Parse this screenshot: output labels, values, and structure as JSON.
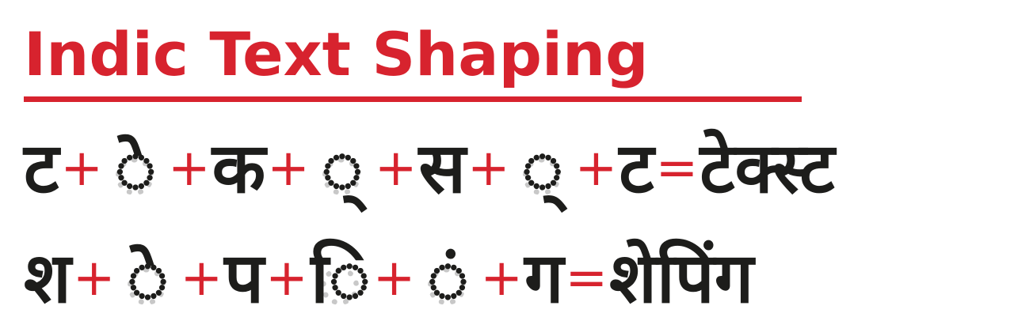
{
  "title": "Indic Text Shaping",
  "colors": {
    "title": "#d7232e",
    "glyph": "#1d1d1b",
    "operator": "#d7232e",
    "placeholder": "#c8c8c8"
  },
  "rows": [
    {
      "parts": [
        {
          "kind": "glyph",
          "text": "ट"
        },
        {
          "kind": "op",
          "text": "+"
        },
        {
          "kind": "mark",
          "text": "े"
        },
        {
          "kind": "op",
          "text": "+"
        },
        {
          "kind": "glyph",
          "text": "क"
        },
        {
          "kind": "op",
          "text": "+"
        },
        {
          "kind": "mark",
          "text": "्"
        },
        {
          "kind": "op",
          "text": "+"
        },
        {
          "kind": "glyph",
          "text": "स"
        },
        {
          "kind": "op",
          "text": "+"
        },
        {
          "kind": "mark",
          "text": "्"
        },
        {
          "kind": "op",
          "text": "+"
        },
        {
          "kind": "glyph",
          "text": "ट"
        },
        {
          "kind": "op",
          "text": "="
        },
        {
          "kind": "result",
          "text": "टेक्स्ट"
        }
      ]
    },
    {
      "parts": [
        {
          "kind": "glyph",
          "text": "श"
        },
        {
          "kind": "op",
          "text": "+"
        },
        {
          "kind": "mark",
          "text": "े"
        },
        {
          "kind": "op",
          "text": "+"
        },
        {
          "kind": "glyph",
          "text": "प"
        },
        {
          "kind": "op",
          "text": "+"
        },
        {
          "kind": "mark",
          "text": "ि"
        },
        {
          "kind": "op",
          "text": "+"
        },
        {
          "kind": "mark",
          "text": "ं"
        },
        {
          "kind": "op",
          "text": "+"
        },
        {
          "kind": "glyph",
          "text": "ग"
        },
        {
          "kind": "op",
          "text": "="
        },
        {
          "kind": "result",
          "text": "शेपिंग"
        }
      ]
    }
  ]
}
